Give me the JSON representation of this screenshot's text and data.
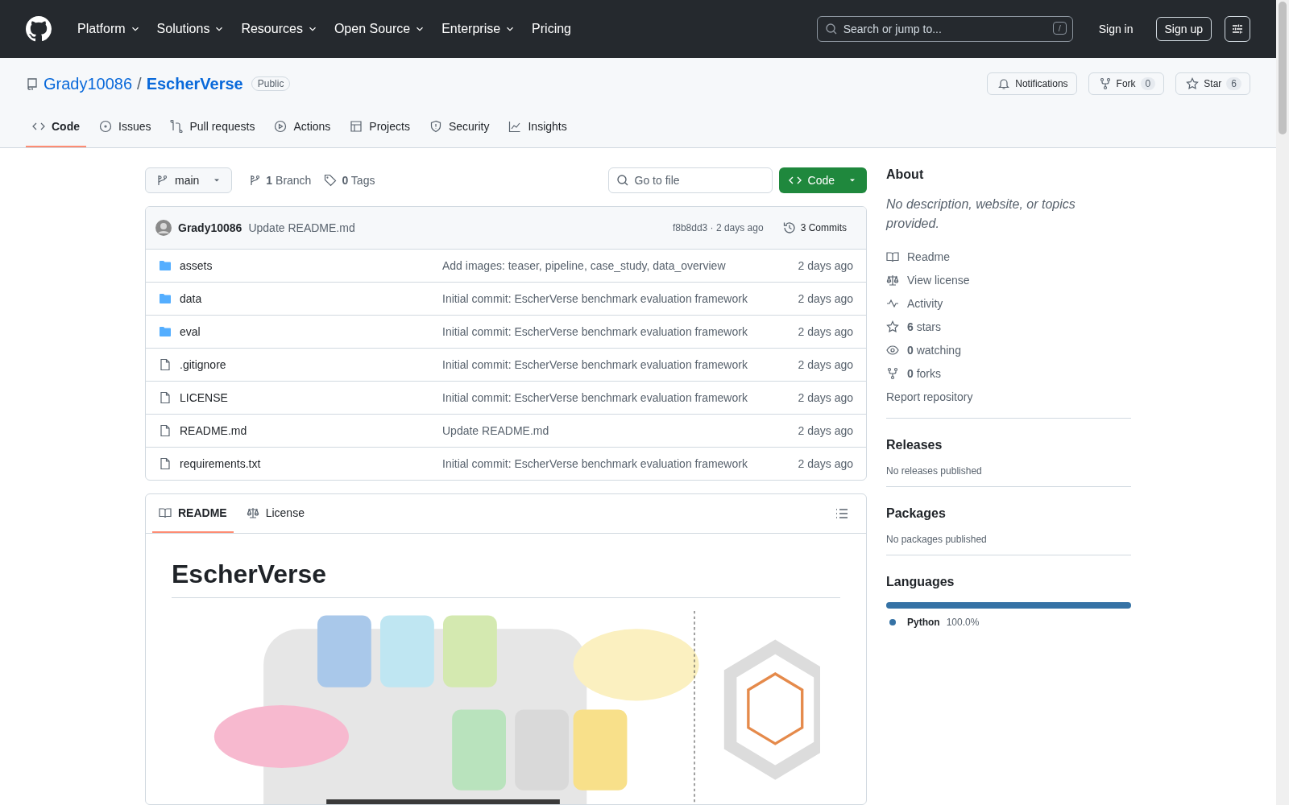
{
  "header": {
    "nav": [
      {
        "label": "Platform",
        "dropdown": true
      },
      {
        "label": "Solutions",
        "dropdown": true
      },
      {
        "label": "Resources",
        "dropdown": true
      },
      {
        "label": "Open Source",
        "dropdown": true
      },
      {
        "label": "Enterprise",
        "dropdown": true
      },
      {
        "label": "Pricing",
        "dropdown": false
      }
    ],
    "search": {
      "placeholder": "Search or jump to...",
      "shortcut": "/"
    },
    "sign_in": "Sign in",
    "sign_up": "Sign up"
  },
  "repo": {
    "owner": "Grady10086",
    "separator": "/",
    "name": "EscherVerse",
    "visibility": "Public",
    "actions": [
      {
        "kind": "bell",
        "label": "Notifications"
      },
      {
        "kind": "fork",
        "label": "Fork",
        "count": "0"
      },
      {
        "kind": "star",
        "label": "Star",
        "count": "6"
      }
    ]
  },
  "tabs": [
    {
      "kind": "code",
      "label": "Code",
      "selected": true
    },
    {
      "kind": "issue",
      "label": "Issues",
      "selected": false
    },
    {
      "kind": "pr",
      "label": "Pull requests",
      "selected": false
    },
    {
      "kind": "play",
      "label": "Actions",
      "selected": false
    },
    {
      "kind": "table",
      "label": "Projects",
      "selected": false
    },
    {
      "kind": "shield",
      "label": "Security",
      "selected": false
    },
    {
      "kind": "graph",
      "label": "Insights",
      "selected": false
    }
  ],
  "toolbar": {
    "branch": "main",
    "branches": "**1** Branch",
    "tags": "**0** Tags",
    "go_to_file": {
      "placeholder": "Go to file"
    },
    "code_button": "Code"
  },
  "latest_commit": {
    "author": "Grady10086",
    "message": "Update README.md",
    "hash_age": "f8b8dd3 · 2 days ago",
    "commits": "3 Commits"
  },
  "files": [
    {
      "kind": "folder",
      "name": "assets",
      "message": "Add images: teaser, pipeline, case_study, data_overview",
      "age": "2 days ago"
    },
    {
      "kind": "folder",
      "name": "data",
      "message": "Initial commit: EscherVerse benchmark evaluation framework",
      "age": "2 days ago"
    },
    {
      "kind": "folder",
      "name": "eval",
      "message": "Initial commit: EscherVerse benchmark evaluation framework",
      "age": "2 days ago"
    },
    {
      "kind": "file",
      "name": ".gitignore",
      "message": "Initial commit: EscherVerse benchmark evaluation framework",
      "age": "2 days ago"
    },
    {
      "kind": "file",
      "name": "LICENSE",
      "message": "Initial commit: EscherVerse benchmark evaluation framework",
      "age": "2 days ago"
    },
    {
      "kind": "file",
      "name": "README.md",
      "message": "Update README.md",
      "age": "2 days ago"
    },
    {
      "kind": "file",
      "name": "requirements.txt",
      "message": "Initial commit: EscherVerse benchmark evaluation framework",
      "age": "2 days ago"
    }
  ],
  "readme": {
    "tabs": [
      {
        "kind": "book",
        "label": "README",
        "selected": true
      },
      {
        "kind": "law",
        "label": "License",
        "selected": false
      }
    ],
    "title": "EscherVerse"
  },
  "about": {
    "title": "About",
    "description": "No description, website, or topics provided.",
    "links": [
      {
        "kind": "book",
        "text": "Readme"
      },
      {
        "kind": "law",
        "text": "View license"
      },
      {
        "kind": "pulse",
        "text": "Activity"
      },
      {
        "kind": "star",
        "text": "**6** stars"
      },
      {
        "kind": "eye",
        "text": "**0** watching"
      },
      {
        "kind": "fork",
        "text": "**0** forks"
      }
    ],
    "report": "Report repository"
  },
  "releases": {
    "title": "Releases",
    "note": "No releases published"
  },
  "packages": {
    "title": "Packages",
    "note": "No packages published"
  },
  "languages": {
    "title": "Languages",
    "items": [
      {
        "name": "Python",
        "percent": "100.0%",
        "level": 1.0,
        "color": "#3572a5"
      }
    ]
  }
}
